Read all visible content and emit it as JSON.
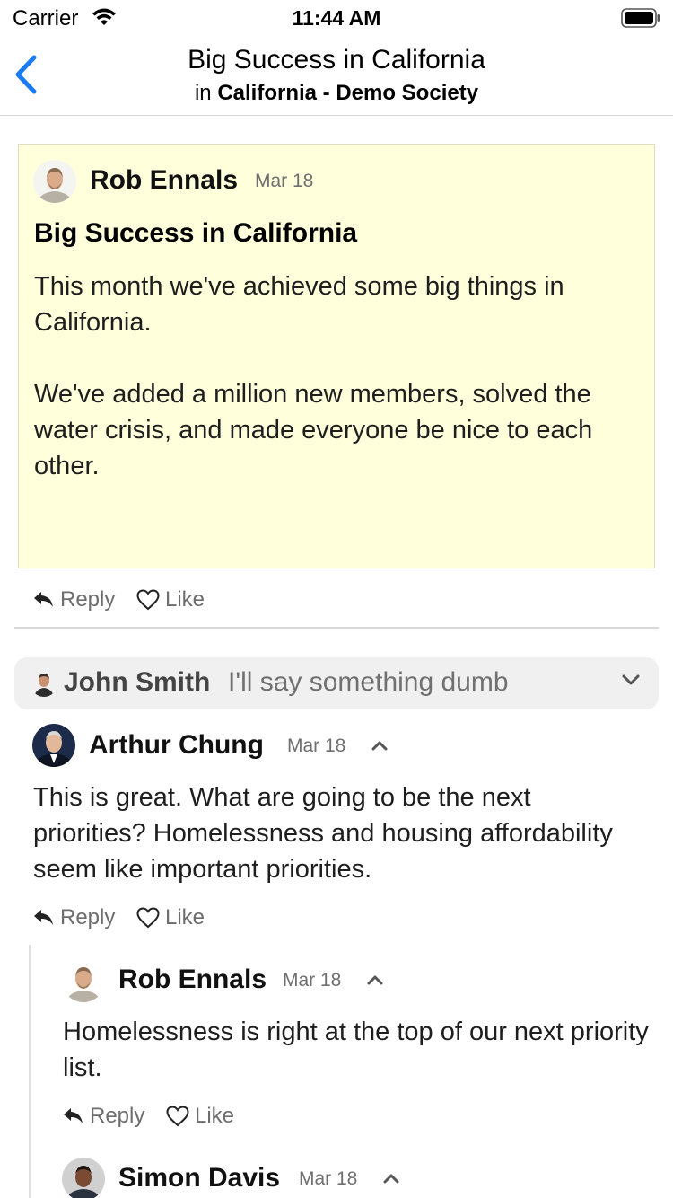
{
  "status_bar": {
    "carrier": "Carrier",
    "time": "11:44 AM"
  },
  "nav": {
    "title": "Big Success in California",
    "subtitle_prefix": "in",
    "group": "California - Demo Society"
  },
  "post": {
    "author": "Rob Ennals",
    "date": "Mar 18",
    "title": "Big Success in California",
    "body": "This month we've achieved some big things in California.\n\nWe've added a million new members, solved the water crisis, and made everyone be nice to each other.",
    "reply_label": "Reply",
    "like_label": "Like"
  },
  "collapsed_comment": {
    "author": "John Smith",
    "preview": "I'll say something dumb"
  },
  "comments": [
    {
      "author": "Arthur Chung",
      "date": "Mar 18",
      "text": "This is great. What are going to be the next priorities? Homelessness and housing affordability seem like important priorities.",
      "reply_label": "Reply",
      "like_label": "Like"
    },
    {
      "author": "Rob Ennals",
      "date": "Mar 18",
      "text": "Homelessness is right at the top of our next priority list.",
      "reply_label": "Reply",
      "like_label": "Like"
    },
    {
      "author": "Simon Davis",
      "date": "Mar 18"
    }
  ],
  "icons": {
    "back": "chevron-left-icon",
    "wifi": "wifi-icon",
    "battery": "battery-icon",
    "reply": "reply-arrow-icon",
    "like": "heart-outline-icon",
    "expand": "chevron-down-icon",
    "collapse": "chevron-up-icon"
  },
  "colors": {
    "accent": "#1a7cf4",
    "post_background": "#ffffdc"
  }
}
